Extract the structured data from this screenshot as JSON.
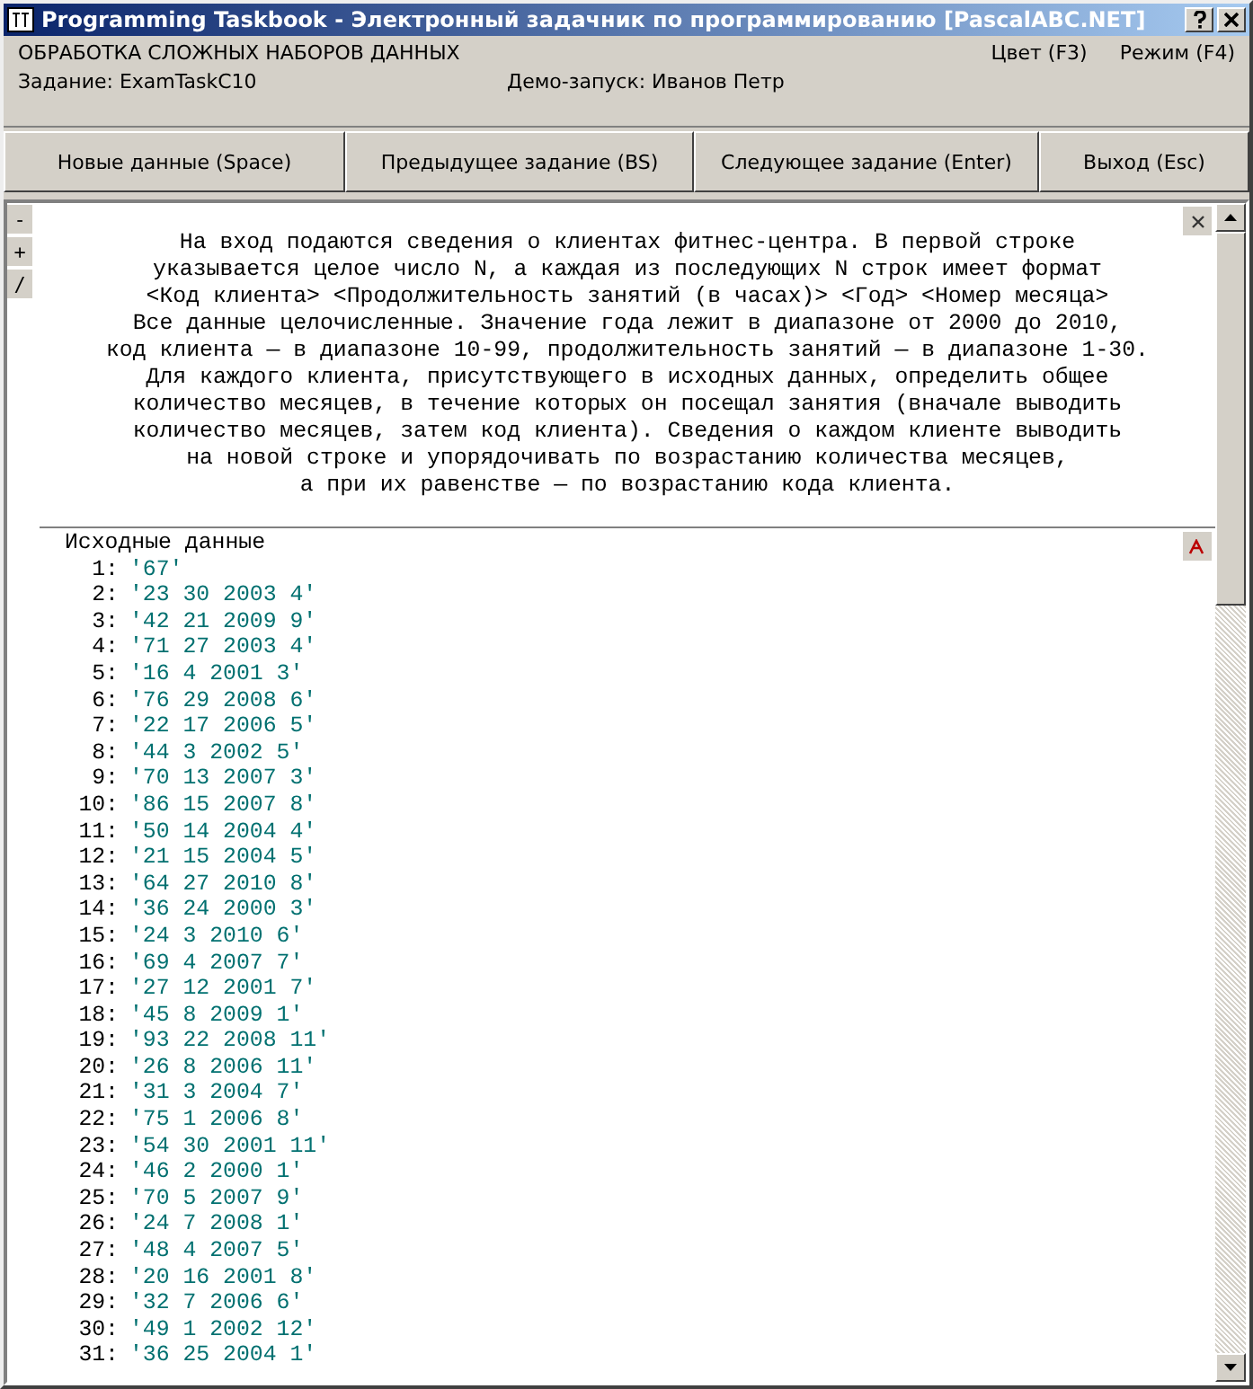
{
  "window": {
    "title": "Programming Taskbook - Электронный задачник по программированию [PascalABC.NET]"
  },
  "header": {
    "section": "ОБРАБОТКА СЛОЖНЫХ НАБОРОВ ДАННЫХ",
    "task": "Задание: ExamTaskC10",
    "demo": "Демо-запуск: Иванов Петр",
    "color_key": "Цвет (F3)",
    "mode_key": "Режим (F4)"
  },
  "buttons": [
    "Новые данные (Space)",
    "Предыдущее задание (BS)",
    "Следующее задание (Enter)",
    "Выход (Esc)"
  ],
  "side_buttons": [
    "-",
    "+",
    "/"
  ],
  "task_lines": [
    "На вход подаются сведения о клиентах фитнес-центра. В первой строке",
    "указывается целое число N, а каждая из последующих N строк имеет формат",
    "<Код клиента> <Продолжительность занятий (в часах)> <Год> <Номер месяца>",
    "Все данные целочисленные. Значение года лежит в диапазоне от 2000 до 2010,",
    "код клиента — в диапазоне 10-99, продолжительность занятий — в диапазоне 1-30.",
    "Для каждого клиента, присутствующего в исходных данных, определить общее",
    "количество месяцев, в течение которых он посещал занятия (вначале выводить",
    "количество месяцев, затем код клиента). Сведения о каждом клиенте выводить",
    "на новой строке и упорядочивать по возрастанию количества месяцев,",
    "а при их равенстве — по возрастанию кода клиента."
  ],
  "data": {
    "heading": "Исходные данные",
    "rows": [
      {
        "num": "1:",
        "value": "'67'"
      },
      {
        "num": "2:",
        "value": "'23 30 2003 4'"
      },
      {
        "num": "3:",
        "value": "'42 21 2009 9'"
      },
      {
        "num": "4:",
        "value": "'71 27 2003 4'"
      },
      {
        "num": "5:",
        "value": "'16 4 2001 3'"
      },
      {
        "num": "6:",
        "value": "'76 29 2008 6'"
      },
      {
        "num": "7:",
        "value": "'22 17 2006 5'"
      },
      {
        "num": "8:",
        "value": "'44 3 2002 5'"
      },
      {
        "num": "9:",
        "value": "'70 13 2007 3'"
      },
      {
        "num": "10:",
        "value": "'86 15 2007 8'"
      },
      {
        "num": "11:",
        "value": "'50 14 2004 4'"
      },
      {
        "num": "12:",
        "value": "'21 15 2004 5'"
      },
      {
        "num": "13:",
        "value": "'64 27 2010 8'"
      },
      {
        "num": "14:",
        "value": "'36 24 2000 3'"
      },
      {
        "num": "15:",
        "value": "'24 3 2010 6'"
      },
      {
        "num": "16:",
        "value": "'69 4 2007 7'"
      },
      {
        "num": "17:",
        "value": "'27 12 2001 7'"
      },
      {
        "num": "18:",
        "value": "'45 8 2009 1'"
      },
      {
        "num": "19:",
        "value": "'93 22 2008 11'"
      },
      {
        "num": "20:",
        "value": "'26 8 2006 11'"
      },
      {
        "num": "21:",
        "value": "'31 3 2004 7'"
      },
      {
        "num": "22:",
        "value": "'75 1 2006 8'"
      },
      {
        "num": "23:",
        "value": "'54 30 2001 11'"
      },
      {
        "num": "24:",
        "value": "'46 2 2000 1'"
      },
      {
        "num": "25:",
        "value": "'70 5 2007 9'"
      },
      {
        "num": "26:",
        "value": "'24 7 2008 1'"
      },
      {
        "num": "27:",
        "value": "'48 4 2007 5'"
      },
      {
        "num": "28:",
        "value": "'20 16 2001 8'"
      },
      {
        "num": "29:",
        "value": "'32 7 2006 6'"
      },
      {
        "num": "30:",
        "value": "'49 1 2002 12'"
      },
      {
        "num": "31:",
        "value": "'36 25 2004 1'"
      }
    ]
  }
}
